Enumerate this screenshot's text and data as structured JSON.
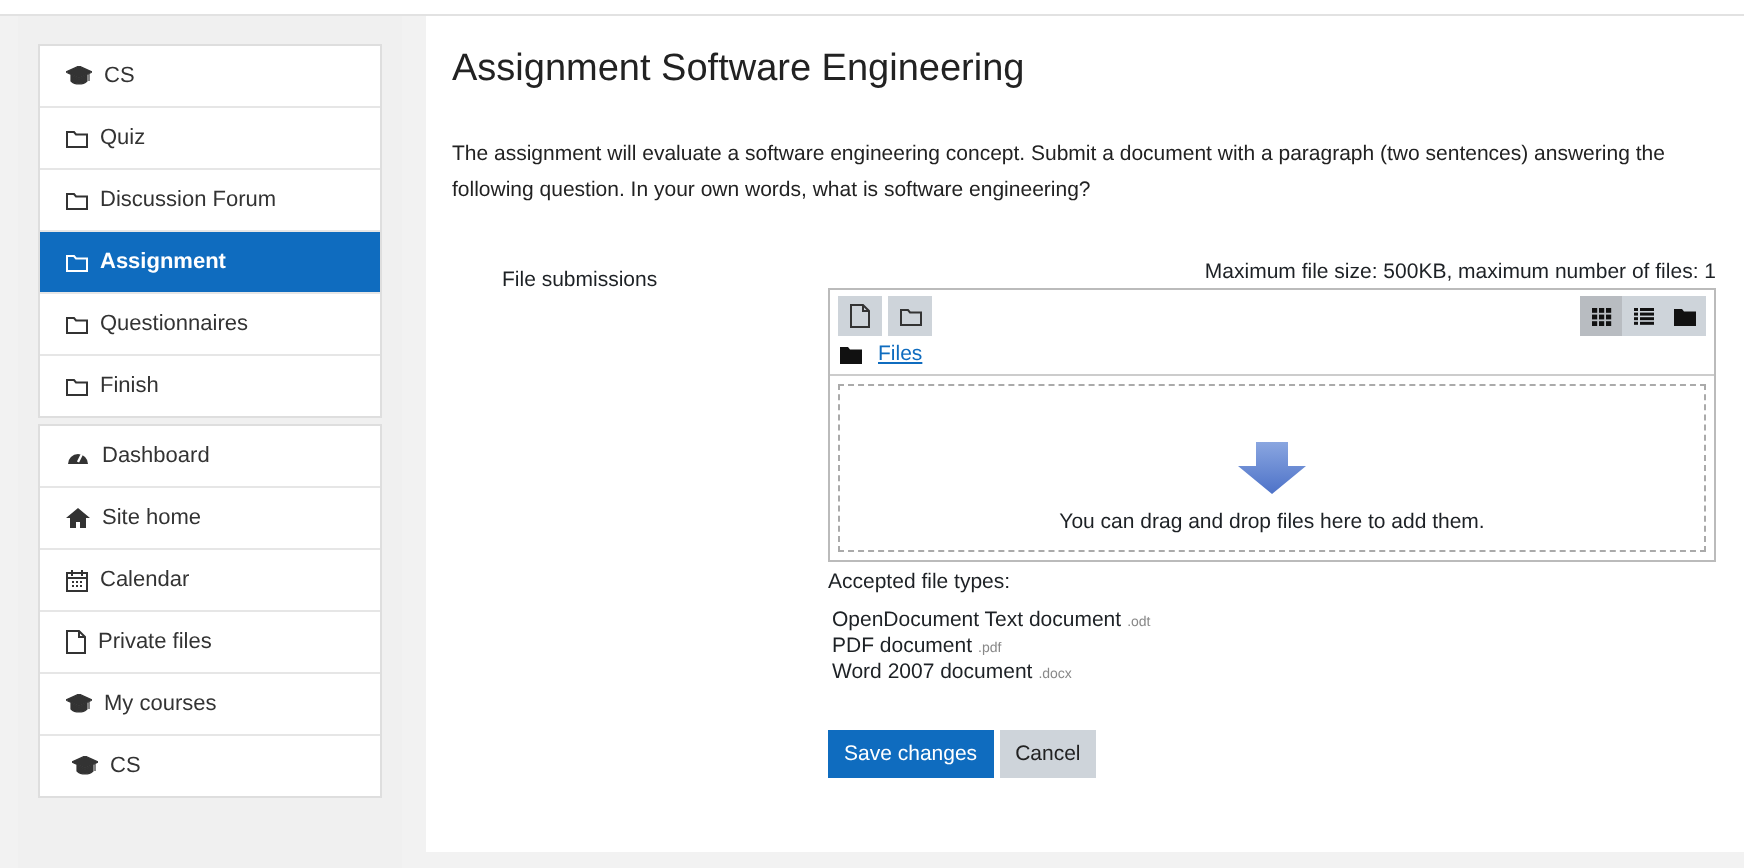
{
  "sidebar": {
    "groups": [
      {
        "items": [
          {
            "label": "CS",
            "kind": "cap",
            "selected": false
          },
          {
            "label": "Quiz",
            "kind": "folder",
            "selected": false
          },
          {
            "label": "Discussion Forum",
            "kind": "folder",
            "selected": false
          },
          {
            "label": "Assignment",
            "kind": "folder",
            "selected": true
          },
          {
            "label": "Questionnaires",
            "kind": "folder",
            "selected": false
          },
          {
            "label": "Finish",
            "kind": "folder",
            "selected": false
          }
        ]
      },
      {
        "items": [
          {
            "label": "Dashboard",
            "kind": "dashboard",
            "selected": false
          },
          {
            "label": "Site home",
            "kind": "home",
            "selected": false
          },
          {
            "label": "Calendar",
            "kind": "calendar",
            "selected": false
          },
          {
            "label": "Private files",
            "kind": "file",
            "selected": false
          },
          {
            "label": "My courses",
            "kind": "cap",
            "selected": false
          },
          {
            "label": "CS",
            "kind": "cap",
            "selected": false,
            "indented": true
          }
        ]
      }
    ]
  },
  "page": {
    "title": "Assignment Software Engineering",
    "description": "The assignment will evaluate a software engineering concept. Submit a document with a paragraph (two sentences) answering the following question. In your own words, what is software engineering?"
  },
  "form": {
    "label": "File submissions",
    "limits": "Maximum file size: 500KB, maximum number of files: 1",
    "file_picker": {
      "toolbar": [
        {
          "kind": "file"
        },
        {
          "kind": "folder"
        }
      ],
      "views": [
        {
          "kind": "grid",
          "selected": true
        },
        {
          "kind": "list",
          "selected": false
        },
        {
          "kind": "tree",
          "selected": false
        }
      ],
      "path": "Files",
      "drop_hint": "You can drag and drop files here to add them."
    },
    "accepted_title": "Accepted file types:",
    "accepted": [
      {
        "name": "OpenDocument Text document",
        "ext": ".odt"
      },
      {
        "name": "PDF document",
        "ext": ".pdf"
      },
      {
        "name": "Word 2007 document",
        "ext": ".docx"
      }
    ],
    "buttons": [
      {
        "label": "Save changes",
        "kind": "primary"
      },
      {
        "label": "Cancel",
        "kind": "secondary"
      }
    ]
  }
}
